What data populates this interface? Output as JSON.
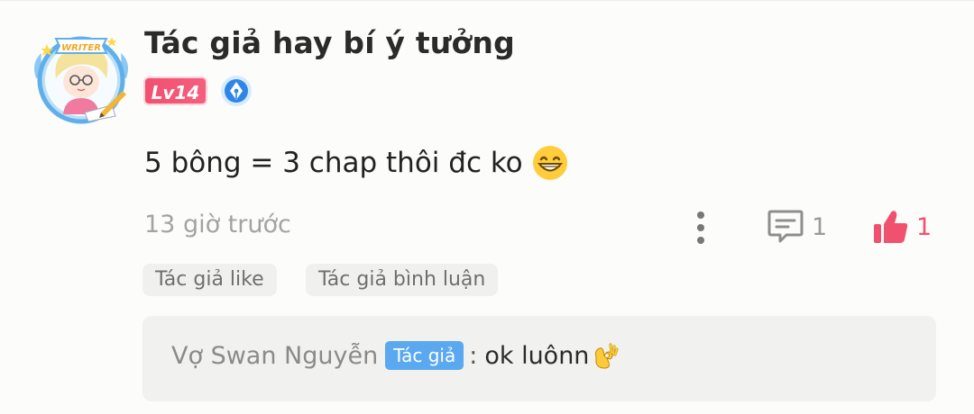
{
  "comment": {
    "username": "Tác giả hay bí ý tưởng",
    "avatar_label": "WRITER",
    "level": "Lv14",
    "writer_badge_icon": "pen-nib-badge-icon",
    "text": "5 bông = 3 chap thôi đc ko",
    "emoji_icon": "grinning-face-emoji",
    "time": "13 giờ trước",
    "more_icon": "vertical-dots-icon",
    "reply_icon": "comment-bubble-icon",
    "reply_count": "1",
    "like_icon": "thumbs-up-icon",
    "like_count": "1",
    "tags": [
      "Tác giả like",
      "Tác giả bình luận"
    ]
  },
  "reply": {
    "author": "Vợ Swan Nguyễn",
    "author_tag": "Tác giả",
    "separator": ":",
    "text": "ok luônn",
    "emoji_icon": "ok-hand-emoji"
  },
  "colors": {
    "accent_pink": "#f0516f",
    "author_tag_blue": "#5aa8f0",
    "badge_blue": "#2f86e6",
    "background": "#fcfcfa"
  }
}
